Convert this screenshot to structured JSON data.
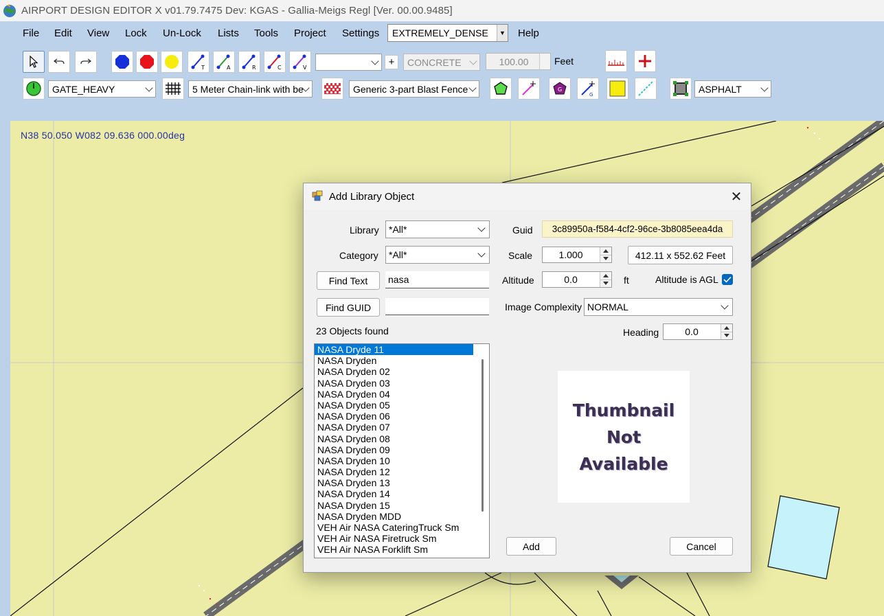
{
  "window": {
    "title": "AIRPORT DESIGN EDITOR X  v01.79.7475 Dev: KGAS - Gallia-Meigs Regl [Ver. 00.00.9485]"
  },
  "menu": {
    "file": "File",
    "edit": "Edit",
    "view": "View",
    "lock": "Lock",
    "unlock": "Un-Lock",
    "lists": "Lists",
    "tools": "Tools",
    "project": "Project",
    "settings": "Settings",
    "density": "EXTREMELY_DENSE",
    "help": "Help"
  },
  "toolbar": {
    "blank_select": "",
    "plus": "+",
    "surface_select": "CONCRETE",
    "width_value": "100.00",
    "width_unit": "Feet",
    "gate_select": "GATE_HEAVY",
    "fence_select": "5 Meter Chain-link with be",
    "blast_fence_select": "Generic 3-part Blast Fence",
    "surface2_select": "ASPHALT"
  },
  "map": {
    "coords": "N38 50.050   W082 09.636 000.00deg"
  },
  "dialog": {
    "title": "Add Library Object",
    "library_label": "Library",
    "library_value": "*All*",
    "category_label": "Category",
    "category_value": "*All*",
    "find_text_button": "Find Text",
    "find_text_value": "nasa",
    "find_guid_button": "Find GUID",
    "find_guid_value": "",
    "objects_found": "23 Objects found",
    "guid_label": "Guid",
    "guid_value": "3c89950a-f584-4cf2-96ce-3b8085eea4da",
    "scale_label": "Scale",
    "scale_value": "1.000",
    "dimensions": "412.11 x 552.62 Feet",
    "altitude_label": "Altitude",
    "altitude_value": "0.0",
    "altitude_unit": "ft",
    "agl_label": "Altitude is AGL",
    "agl_checked": true,
    "complexity_label": "Image Complexity",
    "complexity_value": "NORMAL",
    "heading_label": "Heading",
    "heading_value": "0.0",
    "thumbnail_lines": [
      "Thumbnail",
      "Not",
      "Available"
    ],
    "add_button": "Add",
    "cancel_button": "Cancel",
    "objects": [
      "NASA Dryde 11",
      "NASA Dryden",
      "NASA Dryden 02",
      "NASA Dryden 03",
      "NASA Dryden 04",
      "NASA Dryden 05",
      "NASA Dryden 06",
      "NASA Dryden 07",
      "NASA Dryden 08",
      "NASA Dryden 09",
      "NASA Dryden 10",
      "NASA Dryden 12",
      "NASA Dryden 13",
      "NASA Dryden 14",
      "NASA Dryden 15",
      "NASA Dryden MDD",
      "VEH Air NASA CateringTruck Sm",
      "VEH Air NASA Firetruck Sm",
      "VEH Air NASA Forklift Sm"
    ],
    "selected_index": 0
  },
  "colors": {
    "chrome": "#bcd2ea",
    "map": "#ececa6",
    "selection": "#0078d7",
    "coords_text": "#2431a6"
  }
}
